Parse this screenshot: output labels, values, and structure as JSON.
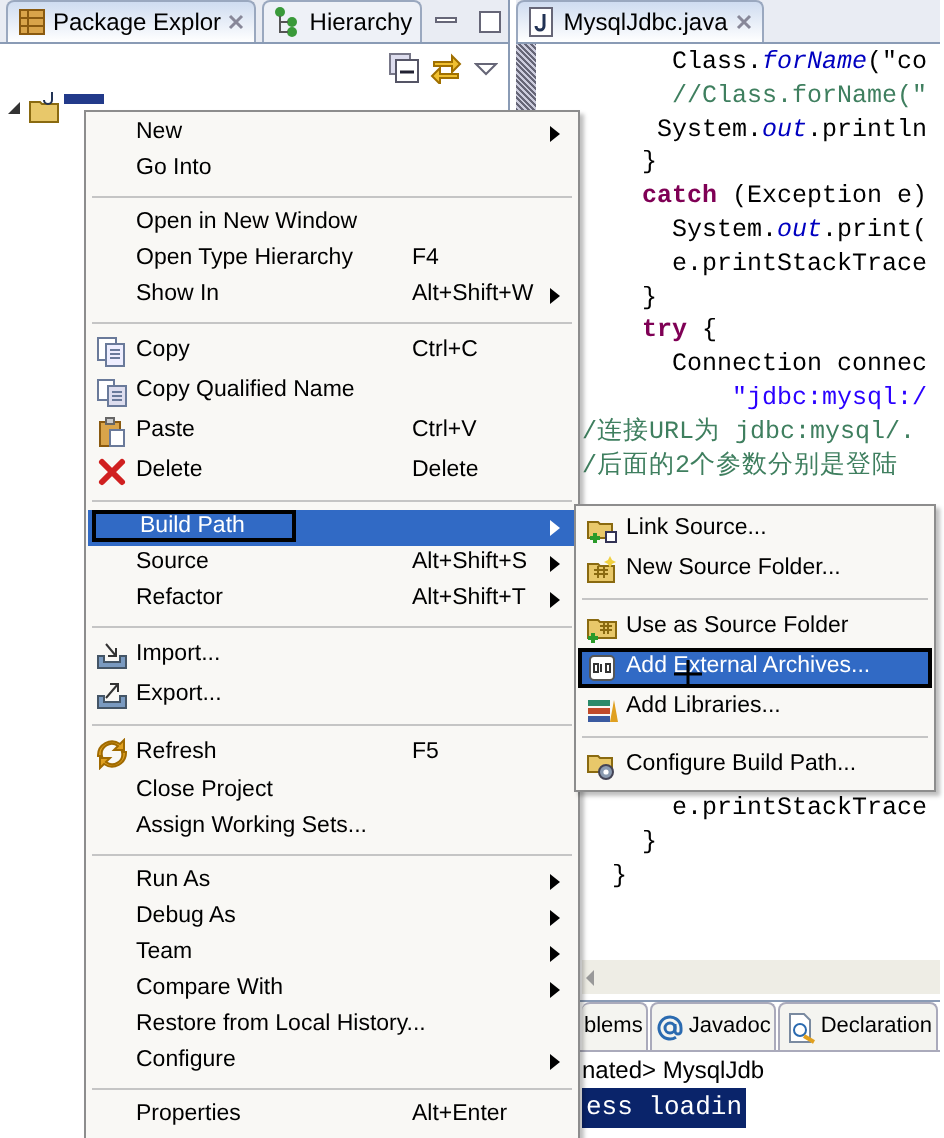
{
  "package_explorer": {
    "tabs": [
      {
        "label": "Package Explor",
        "selected": true,
        "kind": "package"
      },
      {
        "label": "Hierarchy",
        "selected": false,
        "kind": "hierarchy"
      }
    ]
  },
  "editor": {
    "tab": {
      "label": "MysqlJdbc.java"
    },
    "code_blocks": [
      {
        "lines": [
          {
            "text": "      Class.*forName*(\"co",
            "kind": "code"
          },
          {
            "text": "      //Class.forName(\"",
            "kind": "comment"
          },
          {
            "text": "     System.*out*.println",
            "kind": "code"
          },
          {
            "text": "    }",
            "kind": "code"
          },
          {
            "text": "    **catch** (Exception e)",
            "kind": "code"
          },
          {
            "text": "      System.*out*.print(",
            "kind": "code"
          },
          {
            "text": "      e.printStackTrace",
            "kind": "code"
          },
          {
            "text": "    }",
            "kind": "code"
          },
          {
            "text": "    **try** {",
            "kind": "code"
          },
          {
            "text": "      Connection connec",
            "kind": "code"
          },
          {
            "text": "          \"jdbc:mysql:/",
            "kind": "string"
          },
          {
            "text": "/连接URL为 jdbc:mysql/.",
            "kind": "comment"
          },
          {
            "text": "/后面的2个参数分别是登陆",
            "kind": "comment"
          }
        ]
      },
      {
        "lines": [
          {
            "text": "      e.printStackTrace",
            "kind": "code"
          },
          {
            "text": "    }",
            "kind": "code"
          },
          {
            "text": "  }",
            "kind": "code"
          }
        ]
      }
    ]
  },
  "bottom_panel": {
    "tabs": [
      {
        "label": "blems",
        "selected": false,
        "kind": "plain"
      },
      {
        "label": "Javadoc",
        "selected": false,
        "kind": "javadoc"
      },
      {
        "label": "Declaration",
        "selected": false,
        "kind": "declaration"
      }
    ],
    "console_header": "nated> MysqlJdb",
    "console_lines": [
      {
        "text": "ess loadin",
        "selected": true
      }
    ]
  },
  "context_menu": {
    "items": [
      {
        "kind": "plain",
        "label": "New",
        "submenu": true,
        "selected": false
      },
      {
        "kind": "plain",
        "label": "Go Into",
        "selected": false
      },
      {
        "kind": "separator"
      },
      {
        "kind": "plain",
        "label": "Open in New Window",
        "selected": false
      },
      {
        "kind": "plain",
        "label": "Open Type Hierarchy",
        "shortcut": "F4",
        "selected": false
      },
      {
        "kind": "plain",
        "label": "Show In",
        "shortcut": "Alt+Shift+W",
        "submenu": true,
        "selected": false
      },
      {
        "kind": "separator"
      },
      {
        "kind": "copy",
        "label": "Copy",
        "shortcut": "Ctrl+C",
        "selected": false
      },
      {
        "kind": "copyname",
        "label": "Copy Qualified Name",
        "selected": false
      },
      {
        "kind": "paste",
        "label": "Paste",
        "shortcut": "Ctrl+V",
        "selected": false
      },
      {
        "kind": "delete",
        "label": "Delete",
        "shortcut": "Delete",
        "selected": false
      },
      {
        "kind": "separator"
      },
      {
        "kind": "plain",
        "label": "Build Path",
        "submenu": true,
        "selected": true,
        "annotated": true
      },
      {
        "kind": "plain",
        "label": "Source",
        "shortcut": "Alt+Shift+S",
        "submenu": true,
        "selected": false
      },
      {
        "kind": "plain",
        "label": "Refactor",
        "shortcut": "Alt+Shift+T",
        "submenu": true,
        "selected": false
      },
      {
        "kind": "separator"
      },
      {
        "kind": "import",
        "label": "Import...",
        "selected": false
      },
      {
        "kind": "export",
        "label": "Export...",
        "selected": false
      },
      {
        "kind": "separator"
      },
      {
        "kind": "refresh",
        "label": "Refresh",
        "shortcut": "F5",
        "selected": false
      },
      {
        "kind": "plain",
        "label": "Close Project",
        "selected": false
      },
      {
        "kind": "plain",
        "label": "Assign Working Sets...",
        "selected": false
      },
      {
        "kind": "separator"
      },
      {
        "kind": "plain",
        "label": "Run As",
        "submenu": true,
        "selected": false
      },
      {
        "kind": "plain",
        "label": "Debug As",
        "submenu": true,
        "selected": false
      },
      {
        "kind": "plain",
        "label": "Team",
        "submenu": true,
        "selected": false
      },
      {
        "kind": "plain",
        "label": "Compare With",
        "submenu": true,
        "selected": false
      },
      {
        "kind": "plain",
        "label": "Restore from Local History...",
        "selected": false
      },
      {
        "kind": "plain",
        "label": "Configure",
        "submenu": true,
        "selected": false
      },
      {
        "kind": "separator"
      },
      {
        "kind": "plain",
        "label": "Properties",
        "shortcut": "Alt+Enter",
        "selected": false
      }
    ]
  },
  "submenu": {
    "items": [
      {
        "kind": "link",
        "label": "Link Source...",
        "selected": false
      },
      {
        "kind": "newfolder",
        "label": "New Source Folder...",
        "selected": false
      },
      {
        "kind": "separator"
      },
      {
        "kind": "usefolder",
        "label": "Use as Source Folder",
        "selected": false
      },
      {
        "kind": "archive",
        "label": "Add External Archives...",
        "selected": true,
        "annotated": true
      },
      {
        "kind": "library",
        "label": "Add Libraries...",
        "selected": false
      },
      {
        "kind": "separator"
      },
      {
        "kind": "config",
        "label": "Configure Build Path...",
        "selected": false
      }
    ]
  }
}
